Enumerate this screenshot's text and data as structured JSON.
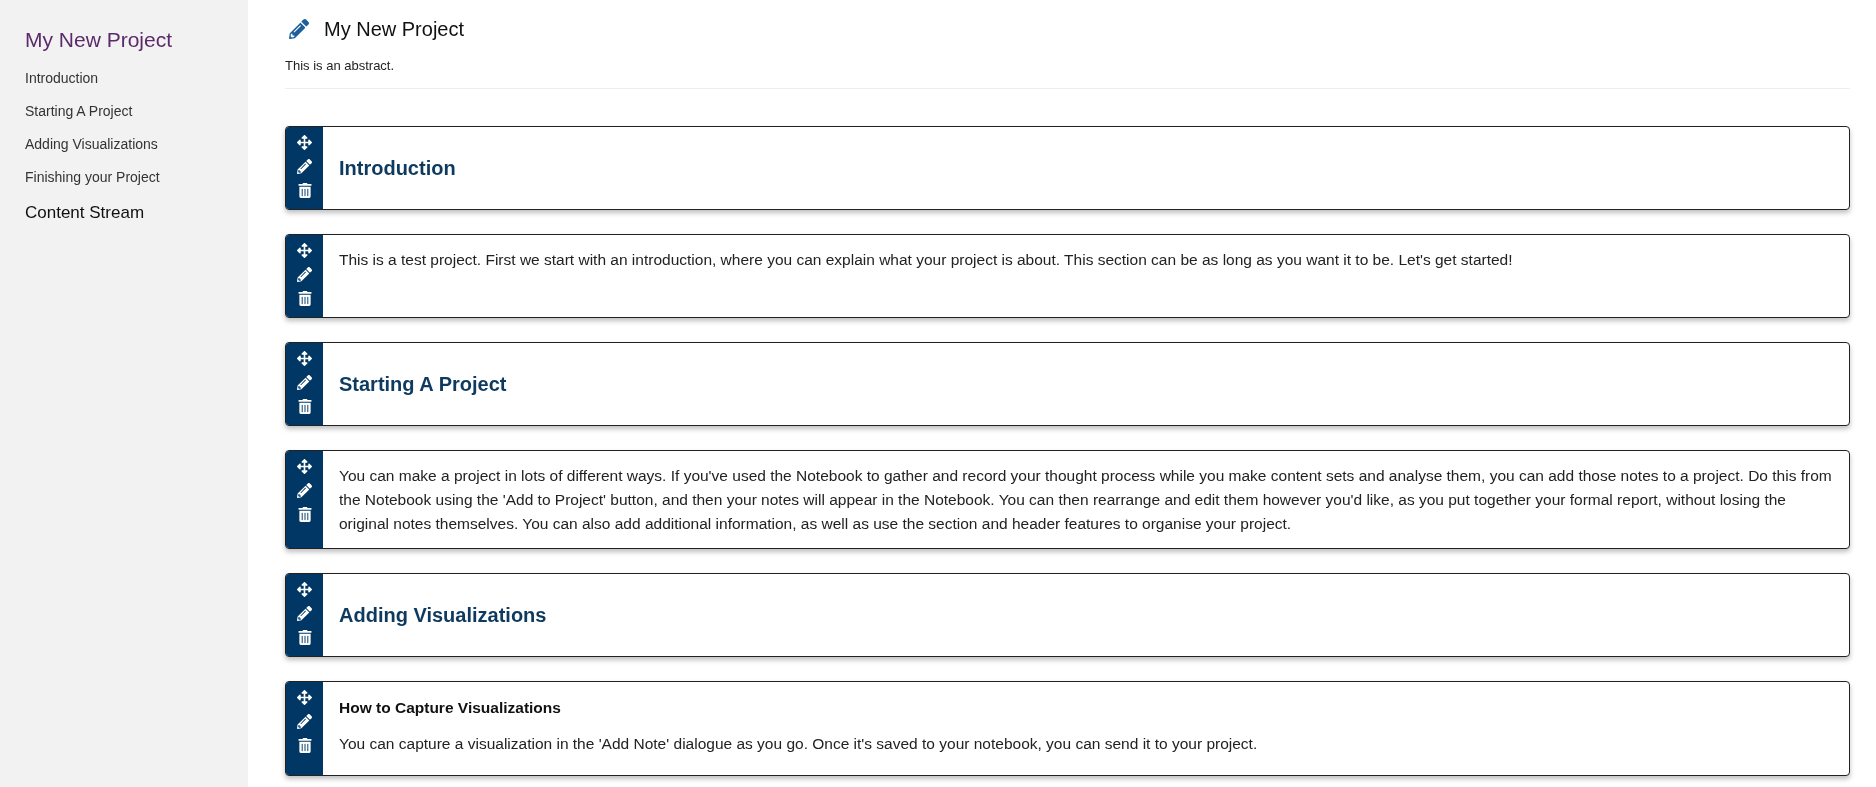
{
  "sidebar": {
    "title": "My New Project",
    "items": [
      {
        "label": "Introduction"
      },
      {
        "label": "Starting A Project"
      },
      {
        "label": "Adding Visualizations"
      },
      {
        "label": "Finishing your Project"
      }
    ],
    "footer": "Content Stream"
  },
  "header": {
    "title": "My New Project",
    "abstract": "This is an abstract."
  },
  "blocks": [
    {
      "kind": "heading",
      "text": "Introduction"
    },
    {
      "kind": "text",
      "text": "This is a test project. First we start with an introduction, where you can explain what your project is about. This section can be as long as you want it to be. Let's get started!"
    },
    {
      "kind": "heading",
      "text": "Starting A Project"
    },
    {
      "kind": "text",
      "text": "You can make a project in lots of different ways. If you've used the Notebook to gather and record your thought process while you make content sets and analyse them, you can add those notes to a project. Do this from the Notebook using the 'Add to Project' button, and then your notes will appear in the Notebook. You can then rearrange and edit them however you'd like, as you put together your formal report, without losing the original notes themselves. You can also add additional information, as well as use the section and header features to organise your project."
    },
    {
      "kind": "heading",
      "text": "Adding Visualizations"
    },
    {
      "kind": "note",
      "title": "How to Capture Visualizations",
      "text": "You can capture a visualization in the 'Add Note' dialogue as you go. Once it's saved to your notebook, you can send it to your project."
    }
  ]
}
